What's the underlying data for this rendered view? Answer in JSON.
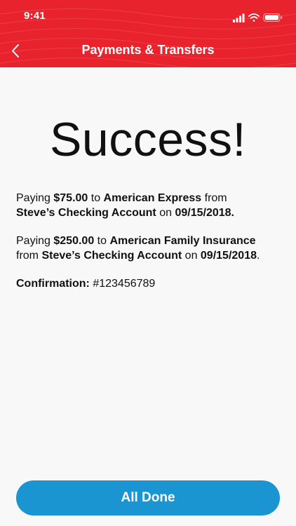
{
  "status_bar": {
    "time": "9:41"
  },
  "header": {
    "title": "Payments & Transfers",
    "back_icon": "chevron-left-icon",
    "background_color": "#e8232d"
  },
  "main": {
    "heading": "Success!",
    "payments": [
      {
        "prefix": "Paying ",
        "amount": "$75.00",
        "to_word": " to ",
        "payee": "American Express",
        "from_word": " from ",
        "account": "Steve’s Checking Account",
        "on_word": " on ",
        "date": "09/15/2018.",
        "suffix": ""
      },
      {
        "prefix": "Paying ",
        "amount": "$250.00",
        "to_word": " to ",
        "payee": "American Family Insurance",
        "from_word": " from ",
        "account": "Steve’s Checking Account",
        "on_word": " on ",
        "date": "09/15/2018",
        "suffix": "."
      }
    ],
    "confirmation": {
      "label": "Confirmation:",
      "value": " #123456789"
    }
  },
  "footer": {
    "done_label": "All Done",
    "button_color": "#1a95d1"
  }
}
